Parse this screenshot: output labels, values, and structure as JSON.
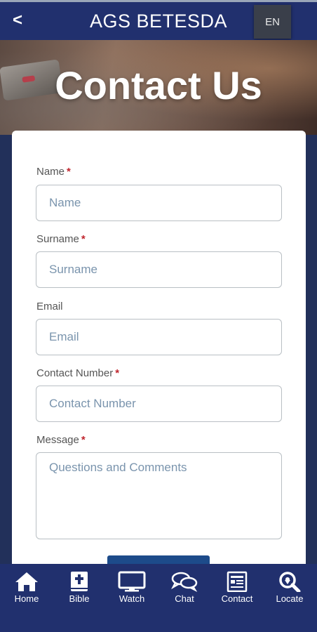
{
  "header": {
    "back_label": "<",
    "title": "AGS BETESDA",
    "language": "EN"
  },
  "hero": {
    "title": "Contact Us"
  },
  "form": {
    "required_mark": "*",
    "name": {
      "label": "Name",
      "placeholder": "Name",
      "required": true
    },
    "surname": {
      "label": "Surname",
      "placeholder": "Surname",
      "required": true
    },
    "email": {
      "label": "Email",
      "placeholder": "Email",
      "required": false
    },
    "contact_number": {
      "label": "Contact Number",
      "placeholder": "Contact Number",
      "required": true
    },
    "message": {
      "label": "Message",
      "placeholder": "Questions and Comments",
      "required": true
    }
  },
  "bottom_nav": {
    "items": [
      {
        "label": "Home",
        "icon": "home-icon"
      },
      {
        "label": "Bible",
        "icon": "bible-icon"
      },
      {
        "label": "Watch",
        "icon": "tv-icon"
      },
      {
        "label": "Chat",
        "icon": "chat-icon"
      },
      {
        "label": "Contact",
        "icon": "contact-form-icon"
      },
      {
        "label": "Locate",
        "icon": "search-location-icon"
      }
    ]
  },
  "colors": {
    "header_bg": "#21306e",
    "required": "#c0262e",
    "button": "#1d4b8a",
    "placeholder": "#7a94ad"
  }
}
